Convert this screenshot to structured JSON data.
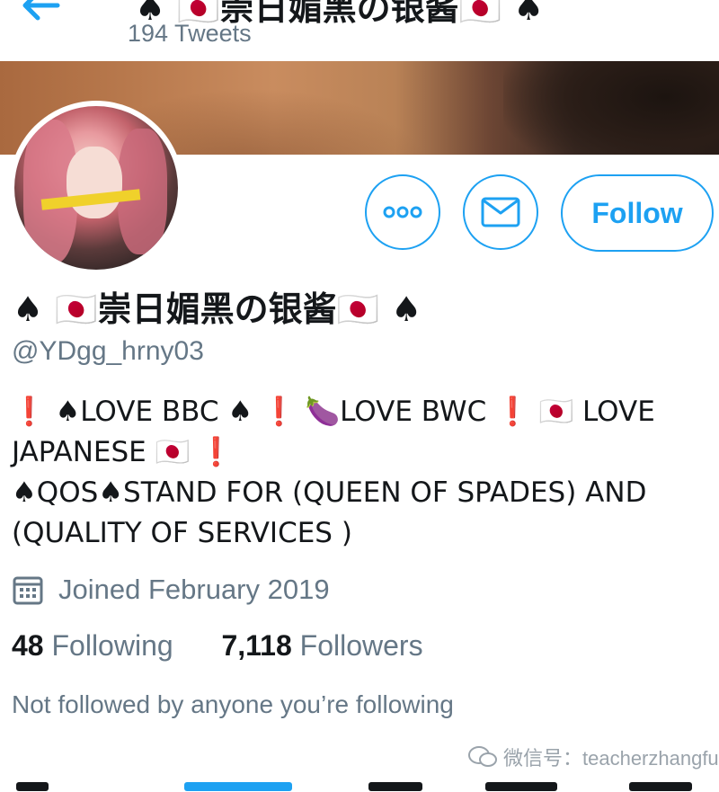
{
  "header": {
    "title": "♠ 🇯🇵崇日媚黑の银酱🇯🇵 ♠",
    "tweet_count": "194 Tweets"
  },
  "profile": {
    "display_name": "♠ 🇯🇵崇日媚黑の银酱🇯🇵 ♠",
    "handle": "@YDgg_hrny03",
    "bio": "❗ ♠LOVE BBC ♠ ❗ 🍆LOVE BWC ❗ 🇯🇵 LOVE\nJAPANESE 🇯🇵 ❗\n♠QOS♠STAND FOR (QUEEN OF SPADES) AND\n(QUALITY OF SERVICES )",
    "joined": "Joined February 2019",
    "following_count": "48",
    "following_label": "Following",
    "followers_count": "7,118",
    "followers_label": "Followers",
    "not_followed_text": "Not followed by anyone you’re following"
  },
  "actions": {
    "more_icon": "more-dots-icon",
    "message_icon": "envelope-icon",
    "follow_label": "Follow"
  },
  "watermark": {
    "text": "微信号：teacherzhangfu"
  },
  "colors": {
    "accent": "#1da1f2",
    "secondary_text": "#657786",
    "primary_text": "#14171a"
  }
}
